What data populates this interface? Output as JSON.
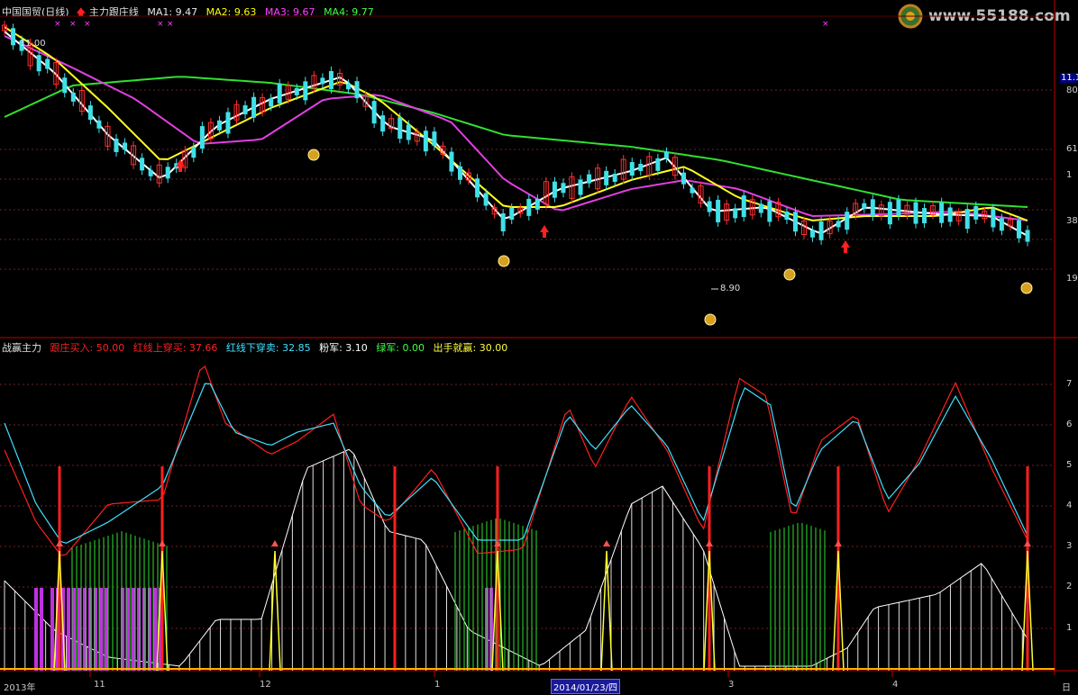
{
  "header": {
    "stock": "中国国贸(日线)",
    "indicator": "主力跟庄线",
    "ma": [
      {
        "label": "MA1: 9.47",
        "color": "#e8e8e8"
      },
      {
        "label": "MA2: 9.63",
        "color": "#ffff00"
      },
      {
        "label": "MA3: 9.67",
        "color": "#ff40ff"
      },
      {
        "label": "MA4: 9.77",
        "color": "#40ff40"
      }
    ]
  },
  "watermark": {
    "text": "www.55188.com"
  },
  "price_panel": {
    "y_ticks": [
      "11.1",
      "80",
      "61",
      "1",
      "38",
      "19"
    ],
    "high_annotation": "11.00",
    "low_annotation": "8.90"
  },
  "indicator_panel": {
    "title": "战赢主力",
    "legend": [
      {
        "label": "跟庄买入: 50.00",
        "color": "#ff2020"
      },
      {
        "label": "红线上穿买: 37.66",
        "color": "#ff2020"
      },
      {
        "label": "红线下穿卖: 32.85",
        "color": "#40e0ff"
      },
      {
        "label": "粉军: 3.10",
        "color": "#ffffff"
      },
      {
        "label": "绿军: 0.00",
        "color": "#40ff40"
      },
      {
        "label": "出手就赢: 30.00",
        "color": "#ffff40"
      }
    ],
    "y_ticks": [
      "7",
      "6",
      "5",
      "4",
      "3",
      "2",
      "1"
    ]
  },
  "x_axis": {
    "labels": [
      "2013年",
      "11",
      "12",
      "1",
      "3",
      "4"
    ],
    "cursor_date": "2014/01/23/四",
    "right_label": "日"
  }
}
